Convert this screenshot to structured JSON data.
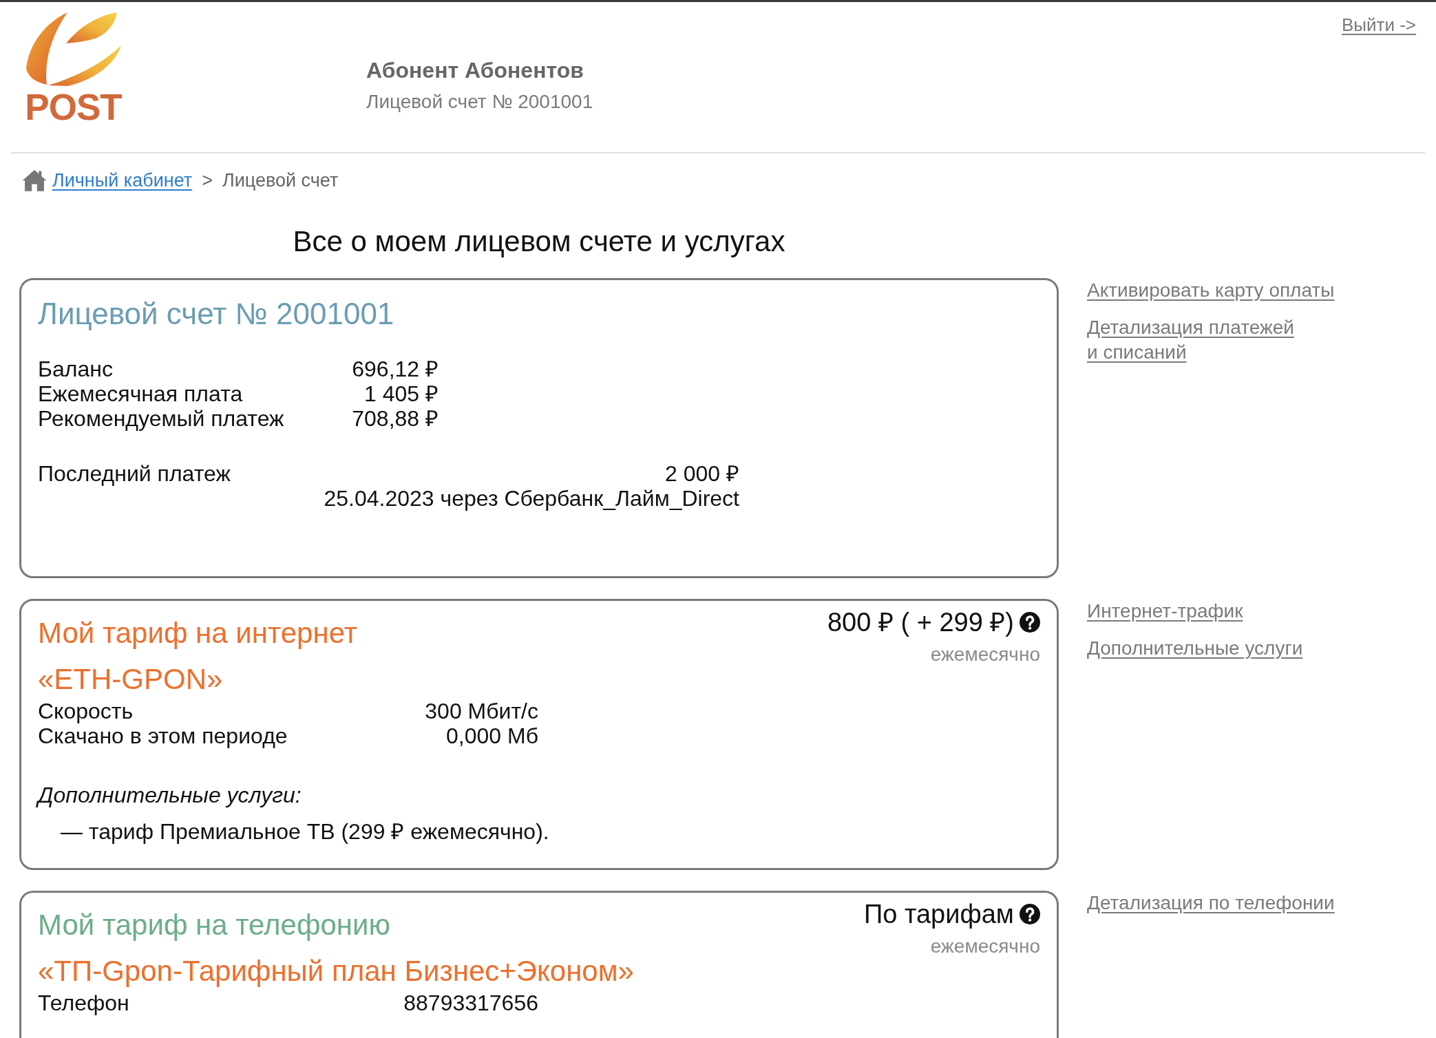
{
  "header": {
    "logo_text": "POST",
    "user_name": "Абонент Абонентов",
    "account_number": "Лицевой счет № 2001001",
    "logout": "Выйти ->"
  },
  "breadcrumb": [
    {
      "kind": "link",
      "label": "Личный кабинет"
    },
    {
      "kind": "separator",
      "label": ">"
    },
    {
      "kind": "current",
      "label": "Лицевой счет"
    }
  ],
  "page_title": "Все о моем лицевом счете и услугах",
  "sections": [
    {
      "kind": "account",
      "title": "Лицевой счет № 2001001",
      "color": "#6b9db4",
      "rows": [
        {
          "label": "Баланс",
          "value": "696,12 ₽"
        },
        {
          "label": "Ежемесячная плата",
          "value": "1 405 ₽"
        },
        {
          "label": "Рекомендуемый платеж",
          "value": "708,88 ₽"
        }
      ],
      "last_payment": {
        "label": "Последний платеж",
        "amount": "2 000 ₽",
        "details": "25.04.2023 через Сбербанк_Лайм_Direct"
      },
      "links": [
        "Активировать карту оплаты",
        "Детализация платежей\nи списаний"
      ]
    },
    {
      "kind": "tariff",
      "title": "Мой тариф на интернет",
      "color": "#ec702d",
      "plan": "«ETH-GPON»",
      "price": "800 ₽ ( + 299 ₽)",
      "period": "ежемесячно",
      "rows": [
        {
          "label": "Скорость",
          "value": "300 Мбит/с"
        },
        {
          "label": "Скачано в этом периоде",
          "value": "0,000 Мб"
        }
      ],
      "extras": {
        "heading": "Дополнительные услуги:",
        "items": [
          "— тариф Премиальное ТВ (299 ₽ ежемесячно)."
        ]
      },
      "links": [
        "Интернет-трафик",
        "Дополнительные услуги"
      ]
    },
    {
      "kind": "tariff",
      "title": "Мой тариф на телефонию",
      "color": "#6cae88",
      "plan": "«ТП-Gpon-Тарифный план Бизнес+Эконом»",
      "price": "По тарифам",
      "period": "ежемесячно",
      "rows": [
        {
          "label": "Телефон",
          "value": "88793317656"
        }
      ],
      "links": [
        "Детализация по телефонии"
      ]
    }
  ]
}
